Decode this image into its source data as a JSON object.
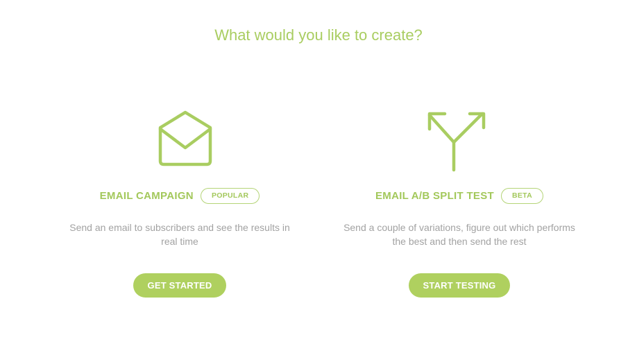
{
  "header": {
    "title": "What would you like to create?"
  },
  "colors": {
    "accent": "#a9cd61",
    "button_bg": "#afd05f",
    "desc_text": "#a2a2a2"
  },
  "cards": [
    {
      "icon": "envelope-icon",
      "title": "EMAIL CAMPAIGN",
      "badge": "POPULAR",
      "description": "Send an email to subscribers and see the results in real time",
      "button_label": "GET STARTED"
    },
    {
      "icon": "split-arrows-icon",
      "title": "EMAIL A/B SPLIT TEST",
      "badge": "BETA",
      "description": "Send a couple of variations, figure out which performs the best and then send the rest",
      "button_label": "START TESTING"
    }
  ]
}
